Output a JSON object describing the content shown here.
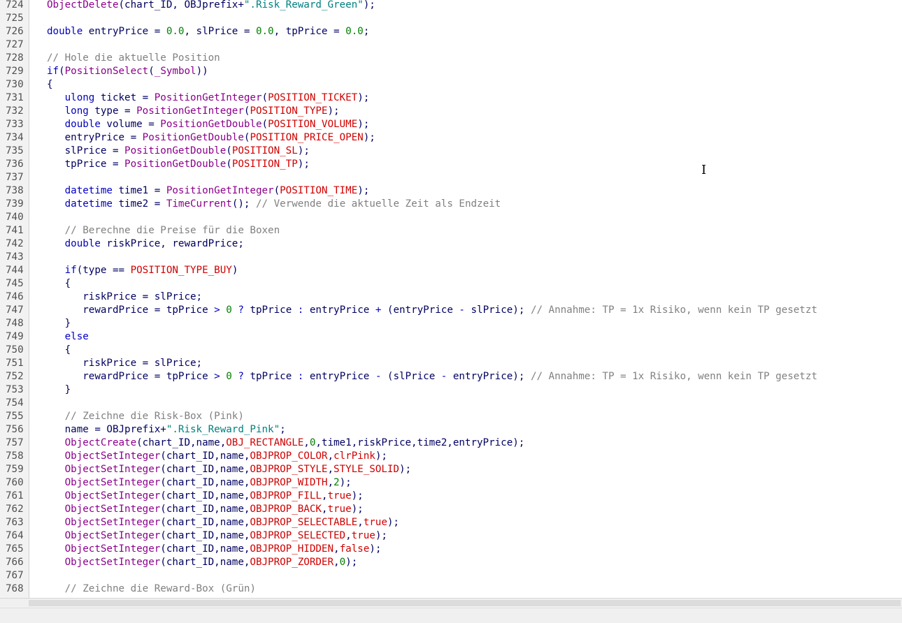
{
  "editor": {
    "lines": [
      {
        "n": "724",
        "tokens": [
          [
            "fn",
            "ObjectDelete"
          ],
          [
            "id",
            "(chart_ID, OBJprefix+"
          ],
          [
            "str",
            "\".Risk_Reward_Green\""
          ],
          [
            "id",
            ");"
          ]
        ]
      },
      {
        "n": "725",
        "tokens": []
      },
      {
        "n": "726",
        "tokens": [
          [
            "kw",
            "double"
          ],
          [
            "id",
            " entryPrice = "
          ],
          [
            "num",
            "0.0"
          ],
          [
            "id",
            ", slPrice = "
          ],
          [
            "num",
            "0.0"
          ],
          [
            "id",
            ", tpPrice = "
          ],
          [
            "num",
            "0.0"
          ],
          [
            "id",
            ";"
          ]
        ]
      },
      {
        "n": "727",
        "tokens": []
      },
      {
        "n": "728",
        "tokens": [
          [
            "cmt",
            "// Hole die aktuelle Position"
          ]
        ]
      },
      {
        "n": "729",
        "tokens": [
          [
            "kw",
            "if"
          ],
          [
            "id",
            "("
          ],
          [
            "fn",
            "PositionSelect"
          ],
          [
            "id",
            "("
          ],
          [
            "fn",
            "_Symbol"
          ],
          [
            "id",
            "))"
          ]
        ]
      },
      {
        "n": "730",
        "tokens": [
          [
            "id",
            "{"
          ]
        ]
      },
      {
        "n": "731",
        "tokens": [
          [
            "id",
            "   "
          ],
          [
            "kw",
            "ulong"
          ],
          [
            "id",
            " ticket = "
          ],
          [
            "fn",
            "PositionGetInteger"
          ],
          [
            "id",
            "("
          ],
          [
            "const",
            "POSITION_TICKET"
          ],
          [
            "id",
            ");"
          ]
        ]
      },
      {
        "n": "732",
        "tokens": [
          [
            "id",
            "   "
          ],
          [
            "kw",
            "long"
          ],
          [
            "id",
            " type = "
          ],
          [
            "fn",
            "PositionGetInteger"
          ],
          [
            "id",
            "("
          ],
          [
            "const",
            "POSITION_TYPE"
          ],
          [
            "id",
            ");"
          ]
        ]
      },
      {
        "n": "733",
        "tokens": [
          [
            "id",
            "   "
          ],
          [
            "kw",
            "double"
          ],
          [
            "id",
            " volume = "
          ],
          [
            "fn",
            "PositionGetDouble"
          ],
          [
            "id",
            "("
          ],
          [
            "const",
            "POSITION_VOLUME"
          ],
          [
            "id",
            ");"
          ]
        ]
      },
      {
        "n": "734",
        "tokens": [
          [
            "id",
            "   entryPrice = "
          ],
          [
            "fn",
            "PositionGetDouble"
          ],
          [
            "id",
            "("
          ],
          [
            "const",
            "POSITION_PRICE_OPEN"
          ],
          [
            "id",
            ");"
          ]
        ]
      },
      {
        "n": "735",
        "tokens": [
          [
            "id",
            "   slPrice = "
          ],
          [
            "fn",
            "PositionGetDouble"
          ],
          [
            "id",
            "("
          ],
          [
            "const",
            "POSITION_SL"
          ],
          [
            "id",
            ");"
          ]
        ]
      },
      {
        "n": "736",
        "tokens": [
          [
            "id",
            "   tpPrice = "
          ],
          [
            "fn",
            "PositionGetDouble"
          ],
          [
            "id",
            "("
          ],
          [
            "const",
            "POSITION_TP"
          ],
          [
            "id",
            ");"
          ]
        ]
      },
      {
        "n": "737",
        "tokens": []
      },
      {
        "n": "738",
        "tokens": [
          [
            "id",
            "   "
          ],
          [
            "kw",
            "datetime"
          ],
          [
            "id",
            " time1 = "
          ],
          [
            "fn",
            "PositionGetInteger"
          ],
          [
            "id",
            "("
          ],
          [
            "const",
            "POSITION_TIME"
          ],
          [
            "id",
            ");"
          ]
        ]
      },
      {
        "n": "739",
        "tokens": [
          [
            "id",
            "   "
          ],
          [
            "kw",
            "datetime"
          ],
          [
            "id",
            " time2 = "
          ],
          [
            "fn",
            "TimeCurrent"
          ],
          [
            "id",
            "(); "
          ],
          [
            "cmt",
            "// Verwende die aktuelle Zeit als Endzeit"
          ]
        ]
      },
      {
        "n": "740",
        "tokens": []
      },
      {
        "n": "741",
        "tokens": [
          [
            "id",
            "   "
          ],
          [
            "cmt",
            "// Berechne die Preise für die Boxen"
          ]
        ]
      },
      {
        "n": "742",
        "tokens": [
          [
            "id",
            "   "
          ],
          [
            "kw",
            "double"
          ],
          [
            "id",
            " riskPrice, rewardPrice;"
          ]
        ]
      },
      {
        "n": "743",
        "tokens": []
      },
      {
        "n": "744",
        "tokens": [
          [
            "id",
            "   "
          ],
          [
            "kw",
            "if"
          ],
          [
            "id",
            "(type == "
          ],
          [
            "const",
            "POSITION_TYPE_BUY"
          ],
          [
            "id",
            ")"
          ]
        ]
      },
      {
        "n": "745",
        "tokens": [
          [
            "id",
            "   {"
          ]
        ]
      },
      {
        "n": "746",
        "tokens": [
          [
            "id",
            "      riskPrice = slPrice;"
          ]
        ]
      },
      {
        "n": "747",
        "tokens": [
          [
            "id",
            "      rewardPrice = tpPrice "
          ],
          [
            "kw",
            ">"
          ],
          [
            "id",
            " "
          ],
          [
            "num",
            "0"
          ],
          [
            "id",
            " "
          ],
          [
            "kw",
            "?"
          ],
          [
            "id",
            " tpPrice "
          ],
          [
            "kw",
            ":"
          ],
          [
            "id",
            " entryPrice "
          ],
          [
            "kw",
            "+"
          ],
          [
            "id",
            " (entryPrice "
          ],
          [
            "kw",
            "-"
          ],
          [
            "id",
            " slPrice); "
          ],
          [
            "cmt",
            "// Annahme: TP = 1x Risiko, wenn kein TP gesetzt"
          ]
        ]
      },
      {
        "n": "748",
        "tokens": [
          [
            "id",
            "   }"
          ]
        ]
      },
      {
        "n": "749",
        "tokens": [
          [
            "id",
            "   "
          ],
          [
            "kw",
            "else"
          ]
        ]
      },
      {
        "n": "750",
        "tokens": [
          [
            "id",
            "   {"
          ]
        ]
      },
      {
        "n": "751",
        "tokens": [
          [
            "id",
            "      riskPrice = slPrice;"
          ]
        ]
      },
      {
        "n": "752",
        "tokens": [
          [
            "id",
            "      rewardPrice = tpPrice "
          ],
          [
            "kw",
            ">"
          ],
          [
            "id",
            " "
          ],
          [
            "num",
            "0"
          ],
          [
            "id",
            " "
          ],
          [
            "kw",
            "?"
          ],
          [
            "id",
            " tpPrice "
          ],
          [
            "kw",
            ":"
          ],
          [
            "id",
            " entryPrice "
          ],
          [
            "kw",
            "-"
          ],
          [
            "id",
            " (slPrice "
          ],
          [
            "kw",
            "-"
          ],
          [
            "id",
            " entryPrice); "
          ],
          [
            "cmt",
            "// Annahme: TP = 1x Risiko, wenn kein TP gesetzt"
          ]
        ]
      },
      {
        "n": "753",
        "tokens": [
          [
            "id",
            "   }"
          ]
        ]
      },
      {
        "n": "754",
        "tokens": []
      },
      {
        "n": "755",
        "tokens": [
          [
            "id",
            "   "
          ],
          [
            "cmt",
            "// Zeichne die Risk-Box (Pink)"
          ]
        ]
      },
      {
        "n": "756",
        "tokens": [
          [
            "id",
            "   name = OBJprefix+"
          ],
          [
            "str",
            "\".Risk_Reward_Pink\""
          ],
          [
            "id",
            ";"
          ]
        ]
      },
      {
        "n": "757",
        "tokens": [
          [
            "id",
            "   "
          ],
          [
            "fn",
            "ObjectCreate"
          ],
          [
            "id",
            "(chart_ID,name,"
          ],
          [
            "const",
            "OBJ_RECTANGLE"
          ],
          [
            "id",
            ","
          ],
          [
            "num",
            "0"
          ],
          [
            "id",
            ",time1,riskPrice,time2,entryPrice);"
          ]
        ]
      },
      {
        "n": "758",
        "tokens": [
          [
            "id",
            "   "
          ],
          [
            "fn",
            "ObjectSetInteger"
          ],
          [
            "id",
            "(chart_ID,name,"
          ],
          [
            "const",
            "OBJPROP_COLOR"
          ],
          [
            "id",
            ","
          ],
          [
            "const",
            "clrPink"
          ],
          [
            "id",
            ");"
          ]
        ]
      },
      {
        "n": "759",
        "tokens": [
          [
            "id",
            "   "
          ],
          [
            "fn",
            "ObjectSetInteger"
          ],
          [
            "id",
            "(chart_ID,name,"
          ],
          [
            "const",
            "OBJPROP_STYLE"
          ],
          [
            "id",
            ","
          ],
          [
            "const",
            "STYLE_SOLID"
          ],
          [
            "id",
            ");"
          ]
        ]
      },
      {
        "n": "760",
        "tokens": [
          [
            "id",
            "   "
          ],
          [
            "fn",
            "ObjectSetInteger"
          ],
          [
            "id",
            "(chart_ID,name,"
          ],
          [
            "const",
            "OBJPROP_WIDTH"
          ],
          [
            "id",
            ","
          ],
          [
            "num",
            "2"
          ],
          [
            "id",
            ");"
          ]
        ]
      },
      {
        "n": "761",
        "tokens": [
          [
            "id",
            "   "
          ],
          [
            "fn",
            "ObjectSetInteger"
          ],
          [
            "id",
            "(chart_ID,name,"
          ],
          [
            "const",
            "OBJPROP_FILL"
          ],
          [
            "id",
            ","
          ],
          [
            "const",
            "true"
          ],
          [
            "id",
            ");"
          ]
        ]
      },
      {
        "n": "762",
        "tokens": [
          [
            "id",
            "   "
          ],
          [
            "fn",
            "ObjectSetInteger"
          ],
          [
            "id",
            "(chart_ID,name,"
          ],
          [
            "const",
            "OBJPROP_BACK"
          ],
          [
            "id",
            ","
          ],
          [
            "const",
            "true"
          ],
          [
            "id",
            ");"
          ]
        ]
      },
      {
        "n": "763",
        "tokens": [
          [
            "id",
            "   "
          ],
          [
            "fn",
            "ObjectSetInteger"
          ],
          [
            "id",
            "(chart_ID,name,"
          ],
          [
            "const",
            "OBJPROP_SELECTABLE"
          ],
          [
            "id",
            ","
          ],
          [
            "const",
            "true"
          ],
          [
            "id",
            ");"
          ]
        ]
      },
      {
        "n": "764",
        "tokens": [
          [
            "id",
            "   "
          ],
          [
            "fn",
            "ObjectSetInteger"
          ],
          [
            "id",
            "(chart_ID,name,"
          ],
          [
            "const",
            "OBJPROP_SELECTED"
          ],
          [
            "id",
            ","
          ],
          [
            "const",
            "true"
          ],
          [
            "id",
            ");"
          ]
        ]
      },
      {
        "n": "765",
        "tokens": [
          [
            "id",
            "   "
          ],
          [
            "fn",
            "ObjectSetInteger"
          ],
          [
            "id",
            "(chart_ID,name,"
          ],
          [
            "const",
            "OBJPROP_HIDDEN"
          ],
          [
            "id",
            ","
          ],
          [
            "const",
            "false"
          ],
          [
            "id",
            ");"
          ]
        ]
      },
      {
        "n": "766",
        "tokens": [
          [
            "id",
            "   "
          ],
          [
            "fn",
            "ObjectSetInteger"
          ],
          [
            "id",
            "(chart_ID,name,"
          ],
          [
            "const",
            "OBJPROP_ZORDER"
          ],
          [
            "id",
            ","
          ],
          [
            "num",
            "0"
          ],
          [
            "id",
            ");"
          ]
        ]
      },
      {
        "n": "767",
        "tokens": []
      },
      {
        "n": "768",
        "tokens": [
          [
            "id",
            "   "
          ],
          [
            "cmt",
            "// Zeichne die Reward-Box (Grün)"
          ]
        ]
      }
    ]
  },
  "colors": {
    "function": "#8b008b",
    "keyword": "#0000c0",
    "string": "#008080",
    "number": "#008000",
    "constant": "#d00000",
    "comment": "#808080",
    "gutter_bg": "#f2f2f2"
  },
  "cursor": {
    "icon": "text-cursor-icon",
    "glyph": "I"
  }
}
